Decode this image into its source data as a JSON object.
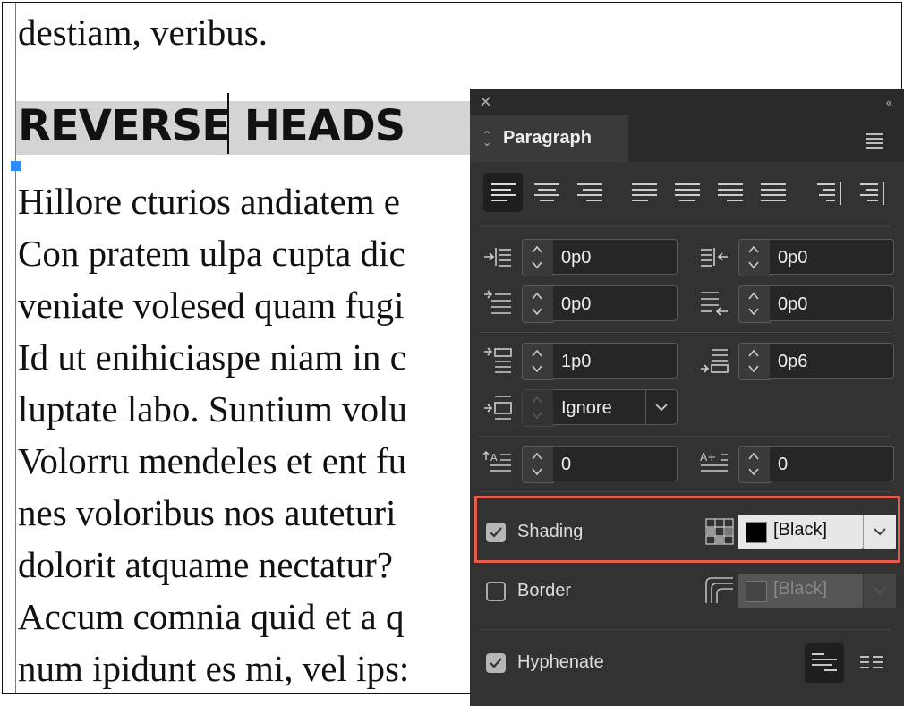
{
  "document": {
    "top_line": "destiam, veribus.",
    "heading": "REVERSE HEADS",
    "body_lines": [
      "Hillore cturios andiatem e",
      "Con pratem ulpa cupta dic",
      "veniate volesed quam fugi",
      "Id ut enihiciaspe niam in c",
      "luptate labo. Suntium volu",
      "Volorru mendeles et ent fu",
      "nes voloribus nos auteturi",
      "dolorit atquame nectatur?",
      "Accum comnia quid et a q",
      "num ipidunt es mi, vel ips:"
    ]
  },
  "panel": {
    "title": "Paragraph",
    "alignment_options": [
      "align-left",
      "align-center",
      "align-right",
      "justify-left",
      "justify-center",
      "justify-right",
      "justify-all",
      "align-towards-spine",
      "align-away-from-spine"
    ],
    "selected_alignment": "align-left",
    "left_indent": "0p0",
    "right_indent": "0p0",
    "first_line_indent": "0p0",
    "last_line_right_indent": "0p0",
    "space_before": "1p0",
    "space_after": "0p6",
    "align_to_grid": "Ignore",
    "drop_cap_lines": "0",
    "drop_cap_chars": "0",
    "shading": {
      "label": "Shading",
      "checked": true,
      "color": "[Black]"
    },
    "border": {
      "label": "Border",
      "checked": false,
      "color": "[Black]"
    },
    "hyphenate": {
      "label": "Hyphenate",
      "checked": true
    }
  },
  "colors": {
    "panel_bg": "#323232",
    "highlight": "#e95b4d",
    "frame_handle": "#2d8cff"
  }
}
